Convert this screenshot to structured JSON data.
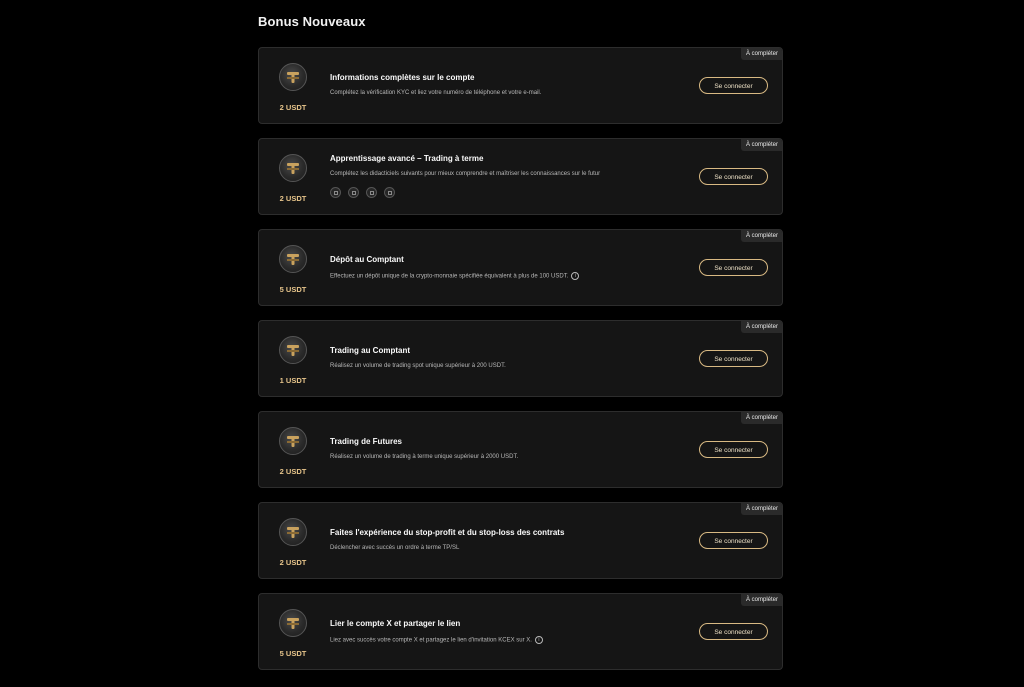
{
  "page": {
    "section_title": "Bonus Nouveaux"
  },
  "tasks": [
    {
      "badge": "À compléter",
      "reward": "2 USDT",
      "title": "Informations complètes sur le compte",
      "description": "Complétez la vérification KYC et liez votre numéro de téléphone et votre e-mail.",
      "button": "Se connecter"
    },
    {
      "badge": "À compléter",
      "reward": "2 USDT",
      "title": "Apprentissage avancé – Trading à terme",
      "description": "Complétez les didacticiels suivants pour mieux comprendre et maîtriser les connaissances sur le futur",
      "button": "Se connecter"
    },
    {
      "badge": "À compléter",
      "reward": "5 USDT",
      "title": "Dépôt au Comptant",
      "description": "Effectuez un dépôt unique de la crypto-monnaie spécifiée équivalent à plus de 100 USDT.",
      "button": "Se connecter"
    },
    {
      "badge": "À compléter",
      "reward": "1 USDT",
      "title": "Trading au Comptant",
      "description": "Réalisez un volume de trading spot unique supérieur à 200 USDT.",
      "button": "Se connecter"
    },
    {
      "badge": "À compléter",
      "reward": "2 USDT",
      "title": "Trading de Futures",
      "description": "Réalisez un volume de trading à terme unique supérieur à 2000 USDT.",
      "button": "Se connecter"
    },
    {
      "badge": "À compléter",
      "reward": "2 USDT",
      "title": "Faites l'expérience du stop-profit et du stop-loss des contrats",
      "description": "Déclencher avec succès un ordre à terme TP/SL",
      "button": "Se connecter"
    },
    {
      "badge": "À compléter",
      "reward": "5 USDT",
      "title": "Lier le compte X et partager le lien",
      "description": "Liez avec succès votre compte X et partagez le lien d'invitation KCEX sur X.",
      "button": "Se connecter"
    }
  ],
  "icons": {
    "reward_coin": "gold-coin-icon",
    "info": "info-icon",
    "tutorial": "tutorial-icon"
  },
  "colors": {
    "background": "#000000",
    "card": "#151515",
    "accent_gold": "#d8b983",
    "reward_text": "#e7c58b"
  }
}
